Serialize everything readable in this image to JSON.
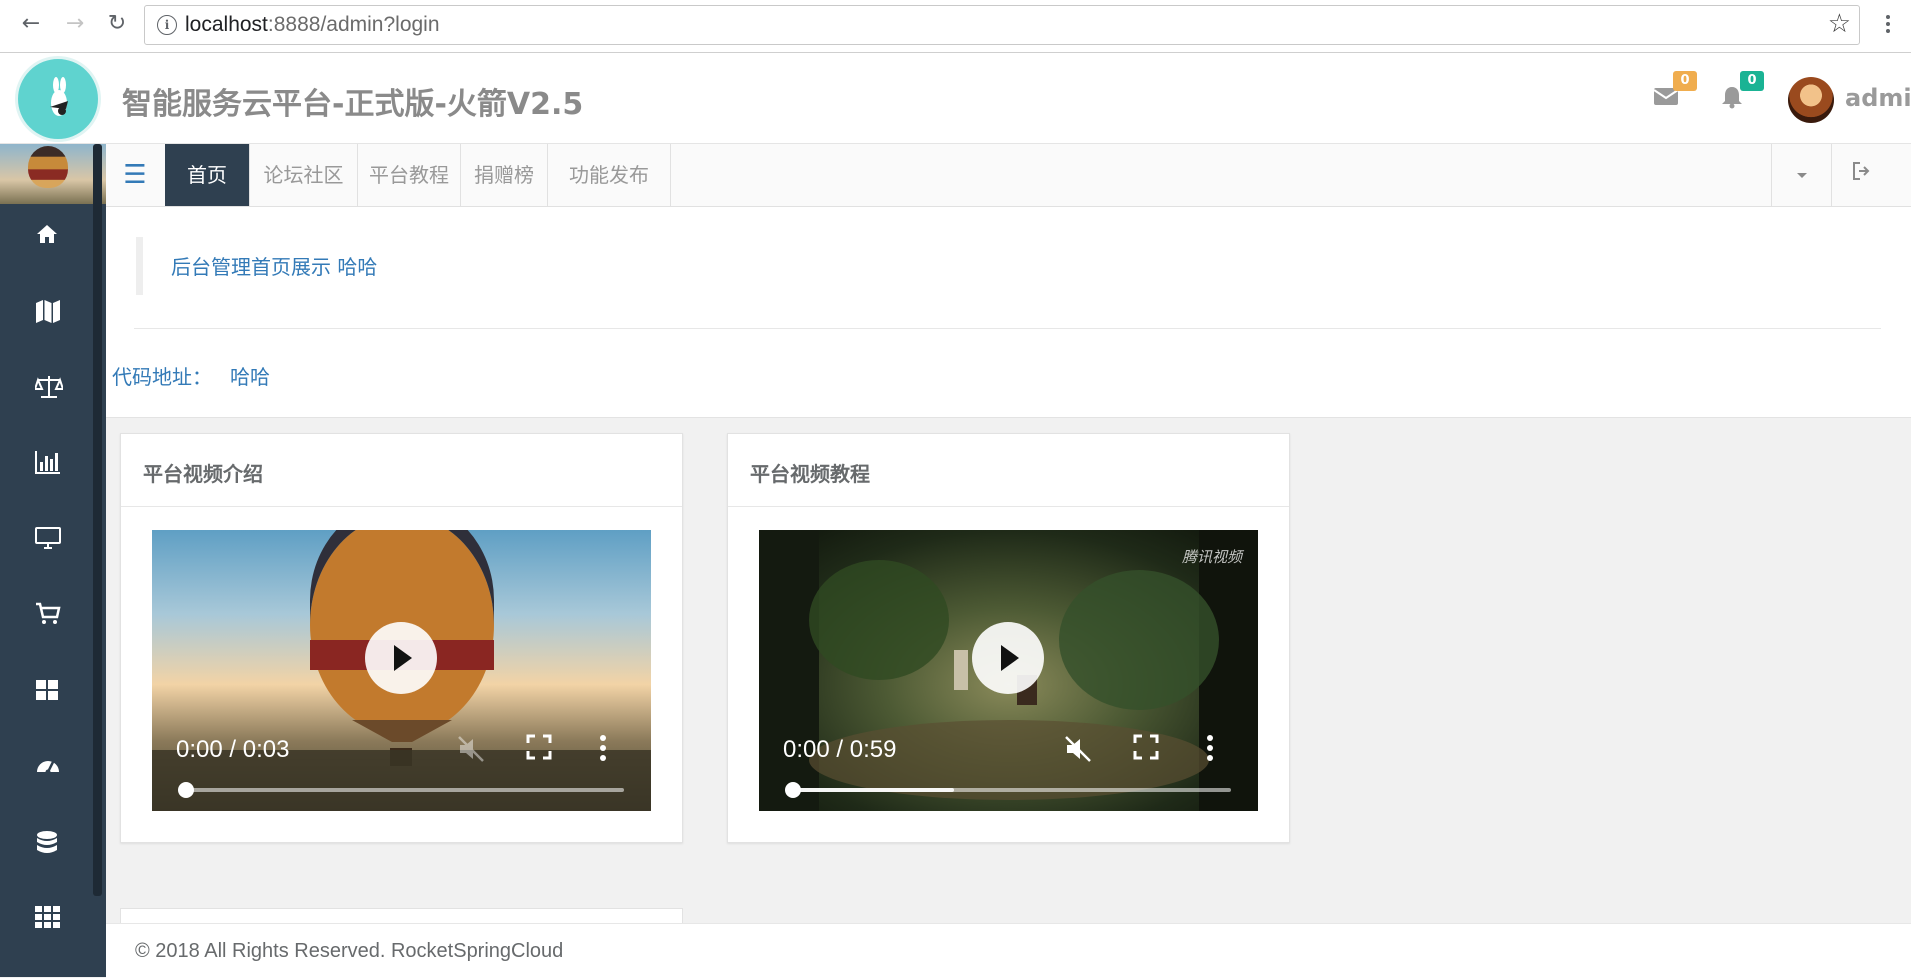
{
  "browser": {
    "url_host": "localhost",
    "url_rest": ":8888/admin?login"
  },
  "header": {
    "title": "智能服务云平台-正式版-火箭V2.5",
    "messages_count": "0",
    "notifications_count": "0",
    "username": "admin"
  },
  "sidebar": {
    "icons": [
      "home-icon",
      "map-icon",
      "balance-scale-icon",
      "bar-chart-icon",
      "desktop-icon",
      "cart-icon",
      "grid-icon",
      "dashboard-icon",
      "database-icon",
      "apps-icon"
    ]
  },
  "tabs": [
    {
      "label": "首页",
      "active": true
    },
    {
      "label": "论坛社区",
      "active": false
    },
    {
      "label": "平台教程",
      "active": false
    },
    {
      "label": "捐赠榜",
      "active": false
    },
    {
      "label": "功能发布",
      "active": false
    }
  ],
  "content": {
    "intro_link": "后台管理首页展示 哈哈",
    "code_label": "代码地址：",
    "code_link": "哈哈"
  },
  "panels": [
    {
      "title": "平台视频介绍",
      "time": "0:00 / 0:03",
      "buffered": 0.0,
      "muted_disabled": true
    },
    {
      "title": "平台视频教程",
      "time": "0:00 / 0:59",
      "buffered": 0.37,
      "watermark": "腾讯视频",
      "muted_disabled": false
    }
  ],
  "footer": {
    "copyright": "© 2018 All Rights Reserved. RocketSpringCloud"
  }
}
